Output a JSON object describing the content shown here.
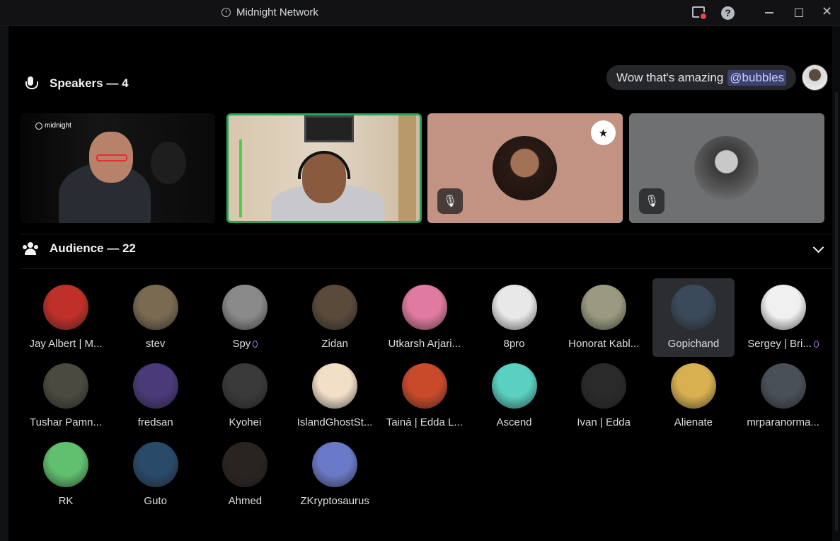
{
  "window": {
    "title": "Midnight Network"
  },
  "speakers": {
    "header": "Speakers — 4",
    "tile_brand": "midnight"
  },
  "chat": {
    "message": "Wow that's amazing",
    "mention": "@bubbles"
  },
  "audience": {
    "header": "Audience — 22",
    "members": [
      {
        "name": "Jay Albert | M...",
        "color": "#c0302a"
      },
      {
        "name": "stev",
        "color": "#7a6a52"
      },
      {
        "name": "Spy",
        "color": "#8a8a8a",
        "badge": true
      },
      {
        "name": "Zidan",
        "color": "#5a4a3a"
      },
      {
        "name": "Utkarsh Arjari...",
        "color": "#e07aa0"
      },
      {
        "name": "8pro",
        "color": "#e8e8e8"
      },
      {
        "name": "Honorat Kabl...",
        "color": "#9a9a80"
      },
      {
        "name": "Gopichand",
        "color": "#3a4a5a",
        "selected": true
      },
      {
        "name": "Sergey | Bri...",
        "color": "#f0f0f0",
        "badge": true
      },
      {
        "name": "Tushar Pamn...",
        "color": "#4a4a40"
      },
      {
        "name": "fredsan",
        "color": "#4a3a7a"
      },
      {
        "name": "Kyohei",
        "color": "#3a3a3a"
      },
      {
        "name": "IslandGhostSt...",
        "color": "#f2dfc8"
      },
      {
        "name": "Tainá | Edda L...",
        "color": "#c84a2a"
      },
      {
        "name": "Ascend",
        "color": "#5ad0c0"
      },
      {
        "name": "Ivan | Edda",
        "color": "#2a2a2a"
      },
      {
        "name": "Alienate",
        "color": "#d8b050"
      },
      {
        "name": "mrparanorma...",
        "color": "#4a5058"
      },
      {
        "name": "RK",
        "color": "#60c070"
      },
      {
        "name": "Guto",
        "color": "#2a4a6a"
      },
      {
        "name": "Ahmed",
        "color": "#2a2420"
      },
      {
        "name": "ZKryptosaurus",
        "color": "#6a7ac8"
      }
    ]
  }
}
